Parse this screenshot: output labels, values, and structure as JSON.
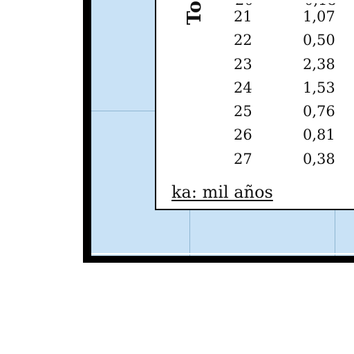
{
  "table": {
    "heading_partial": "To",
    "rows": [
      {
        "id": "21",
        "value": "1,07"
      },
      {
        "id": "22",
        "value": "0,50"
      },
      {
        "id": "23",
        "value": "2,38"
      },
      {
        "id": "24",
        "value": "1,53"
      },
      {
        "id": "25",
        "value": "0,76"
      },
      {
        "id": "26",
        "value": "0,81"
      },
      {
        "id": "27",
        "value": "0,38"
      }
    ],
    "footnote": "ka: mil años"
  },
  "colors": {
    "map_background": "#c9e2f6",
    "frame": "#000000",
    "grid": "#8eb6d2"
  }
}
